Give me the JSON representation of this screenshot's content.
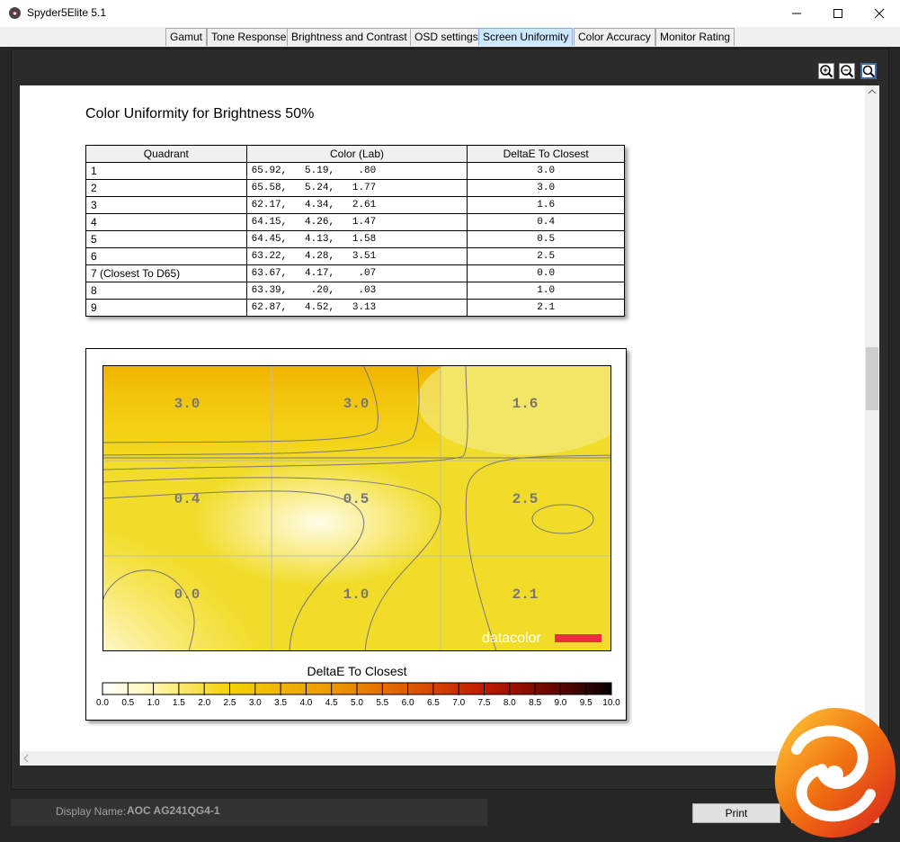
{
  "window": {
    "title": "Spyder5Elite 5.1"
  },
  "tabs": [
    {
      "label": "Gamut"
    },
    {
      "label": "Tone Response"
    },
    {
      "label": "Brightness and Contrast"
    },
    {
      "label": "OSD settings"
    },
    {
      "label": "Screen Uniformity",
      "active": true
    },
    {
      "label": "Color Accuracy"
    },
    {
      "label": "Monitor Rating"
    }
  ],
  "report": {
    "title": "Color Uniformity for Brightness 50%",
    "table": {
      "headers": [
        "Quadrant",
        "Color (Lab)",
        "DeltaE To Closest"
      ],
      "rows": [
        [
          "1",
          "65.92,   5.19,    .80",
          "3.0"
        ],
        [
          "2",
          "65.58,   5.24,   1.77",
          "3.0"
        ],
        [
          "3",
          "62.17,   4.34,   2.61",
          "1.6"
        ],
        [
          "4",
          "64.15,   4.26,   1.47",
          "0.4"
        ],
        [
          "5",
          "64.45,   4.13,   1.58",
          "0.5"
        ],
        [
          "6",
          "63.22,   4.28,   3.51",
          "2.5"
        ],
        [
          "7 (Closest To D65)",
          "63.67,   4.17,    .07",
          "0.0"
        ],
        [
          "8",
          "63.39,    .20,    .03",
          "1.0"
        ],
        [
          "9",
          "62.87,   4.52,   3.13",
          "2.1"
        ]
      ]
    },
    "map_values": [
      "3.0",
      "3.0",
      "1.6",
      "0.4",
      "0.5",
      "2.5",
      "0.0",
      "1.0",
      "2.1"
    ],
    "watermark": "datacolor",
    "legend": {
      "title": "DeltaE To Closest",
      "ticks": [
        "0.0",
        "0.5",
        "1.0",
        "1.5",
        "2.0",
        "2.5",
        "3.0",
        "3.5",
        "4.0",
        "4.5",
        "5.0",
        "5.5",
        "6.0",
        "6.5",
        "7.0",
        "7.5",
        "8.0",
        "8.5",
        "9.0",
        "9.5",
        "10.0"
      ]
    }
  },
  "footer": {
    "display_label": "Display Name:",
    "display_value": "AOC AG241QG4-1",
    "print_label": "Print"
  },
  "colors": {
    "accent_tab": "#cce8ff",
    "frame": "#262626"
  },
  "icons": [
    "app-icon",
    "minimize-icon",
    "maximize-icon",
    "close-icon",
    "zoom-in-icon",
    "zoom-out-icon",
    "zoom-fit-icon",
    "brand-logo-icon"
  ]
}
